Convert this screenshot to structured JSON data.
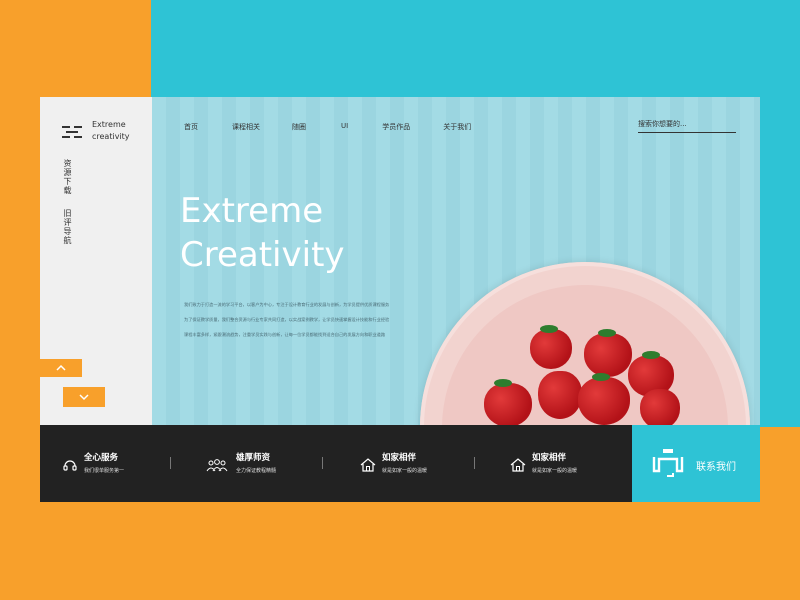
{
  "brand": {
    "line1": "Extreme",
    "line2": "creativity"
  },
  "sidebar": {
    "items": [
      {
        "label": "资源下载"
      },
      {
        "label": "旧评导航"
      }
    ],
    "up_icon": "chevron-up-icon",
    "down_icon": "chevron-down-icon"
  },
  "nav": {
    "items": [
      {
        "label": "首页"
      },
      {
        "label": "课程相关"
      },
      {
        "label": "随圈"
      },
      {
        "label": "UI"
      },
      {
        "label": "学员作品"
      },
      {
        "label": "关于我们"
      }
    ]
  },
  "search": {
    "placeholder": "搜索你想要的..."
  },
  "hero": {
    "title_line1": "Extreme",
    "title_line2": "Creativity",
    "paragraph": [
      "我们致力于打造一流的学习平台，以客户为中心，专注于设计教育行业的发展与创新，为学员提供优质课程服务",
      "为了保证教学质量，我们整合资源与行业专家共同打造，以实战案例教学，让学员快速掌握设计技能和行业经验",
      "课程丰富多样，紧跟潮流趋势，注重学员实践与创新，让每一位学员都能找到适合自己的发展方向和职业道路"
    ]
  },
  "features": [
    {
      "icon": "headset-icon",
      "title": "全心服务",
      "subtitle": "我们很单服务第一"
    },
    {
      "icon": "team-icon",
      "title": "雄厚师资",
      "subtitle": "全力保证教程精髓"
    },
    {
      "icon": "home-icon",
      "title": "如家相伴",
      "subtitle": "就是如家一般的温暖"
    },
    {
      "icon": "home-icon",
      "title": "如家相伴",
      "subtitle": "就是如家一般的温暖"
    }
  ],
  "contact": {
    "label": "联系我们",
    "icon": "contact-icon"
  },
  "colors": {
    "orange": "#f8a02b",
    "teal": "#2ec3d5",
    "dark": "#222222",
    "sidebar": "#f0f0f0"
  }
}
